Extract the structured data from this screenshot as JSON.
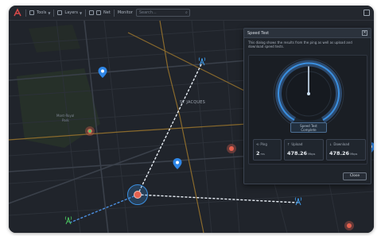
{
  "toolbar": {
    "menu_1": "Tools",
    "menu_2": "Layers",
    "menu_3": "Net",
    "menu_4": "Monitor",
    "search_placeholder": "Search..."
  },
  "map": {
    "area_label": "ST JACQUES",
    "place_label_1": "Mont-Royal",
    "place_label_2": "Park"
  },
  "dialog": {
    "title": "Speed Test",
    "close_glyph": "×",
    "description": "This dialog shows the results from the ping as well as upload and download speed tests.",
    "status_line_1": "Speed Test",
    "status_line_2": "Complete",
    "ping": {
      "label": "Ping",
      "value": "2",
      "unit": "ms"
    },
    "upload": {
      "label": "Upload",
      "value": "478.26",
      "unit": "Mbps"
    },
    "download": {
      "label": "Download",
      "value": "478.26",
      "unit": "Mbps"
    },
    "close_button": "Close"
  },
  "colors": {
    "accent": "#3a8fe0",
    "pin": "#2f86e6",
    "hub": "#e5614f",
    "tower_green": "#49c25e",
    "tower_blue": "#3f9ae8"
  }
}
